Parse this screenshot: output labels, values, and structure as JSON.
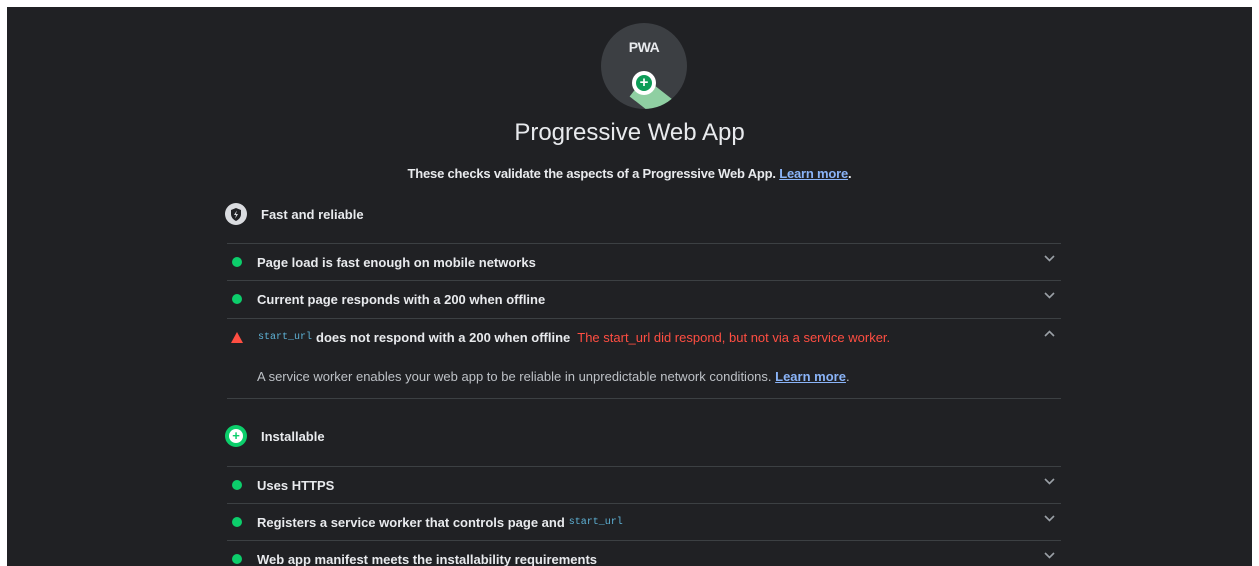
{
  "category": {
    "gauge_label": "PWA",
    "title": "Progressive Web App",
    "description": "These checks validate the aspects of a Progressive Web App.",
    "learn_more": "Learn more"
  },
  "groups": {
    "fast_reliable": {
      "title": "Fast and reliable",
      "icon": "shield-bolt-icon",
      "audits": [
        {
          "status": "pass",
          "label": "Page load is fast enough on mobile networks"
        },
        {
          "status": "pass",
          "label": "Current page responds with a 200 when offline"
        },
        {
          "status": "fail",
          "code": "start_url",
          "label": "does not respond with a 200 when offline",
          "error": "The start_url did respond, but not via a service worker.",
          "expanded": true,
          "detail": "A service worker enables your web app to be reliable in unpredictable network conditions.",
          "detail_link": "Learn more"
        }
      ]
    },
    "installable": {
      "title": "Installable",
      "icon": "plus-circle-icon",
      "audits": [
        {
          "status": "pass",
          "label": "Uses HTTPS"
        },
        {
          "status": "pass",
          "label": "Registers a service worker that controls page and",
          "code": "start_url"
        },
        {
          "status": "pass",
          "label": "Web app manifest meets the installability requirements"
        }
      ]
    }
  },
  "colors": {
    "background": "#202124",
    "pass": "#0cce6b",
    "fail": "#ff4e42",
    "link": "#8ab4f8"
  }
}
